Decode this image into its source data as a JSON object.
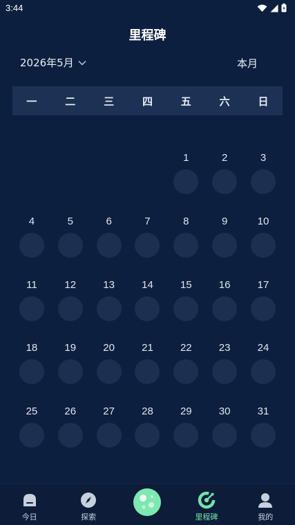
{
  "status_bar": {
    "time": "3:44"
  },
  "header": {
    "title": "里程碑",
    "month_label": "2026年5月",
    "this_month_label": "本月"
  },
  "weekdays": [
    "一",
    "二",
    "三",
    "四",
    "五",
    "六",
    "日"
  ],
  "calendar": {
    "weeks": [
      [
        "",
        "",
        "",
        "",
        "1",
        "2",
        "3"
      ],
      [
        "4",
        "5",
        "6",
        "7",
        "8",
        "9",
        "10"
      ],
      [
        "11",
        "12",
        "13",
        "14",
        "15",
        "16",
        "17"
      ],
      [
        "18",
        "19",
        "20",
        "21",
        "22",
        "23",
        "24"
      ],
      [
        "25",
        "26",
        "27",
        "28",
        "29",
        "30",
        "31"
      ]
    ]
  },
  "nav": {
    "items": [
      {
        "label": "今日",
        "icon": "home-icon"
      },
      {
        "label": "探索",
        "icon": "compass-icon"
      },
      {
        "label": "",
        "icon": "planet-icon"
      },
      {
        "label": "里程碑",
        "icon": "milestone-icon",
        "active": true
      },
      {
        "label": "我的",
        "icon": "user-icon"
      }
    ]
  },
  "colors": {
    "background": "#0d1f3f",
    "weekday_bar": "#1c3154",
    "day_dot": "#1d2f50",
    "accent": "#74e3a9"
  }
}
